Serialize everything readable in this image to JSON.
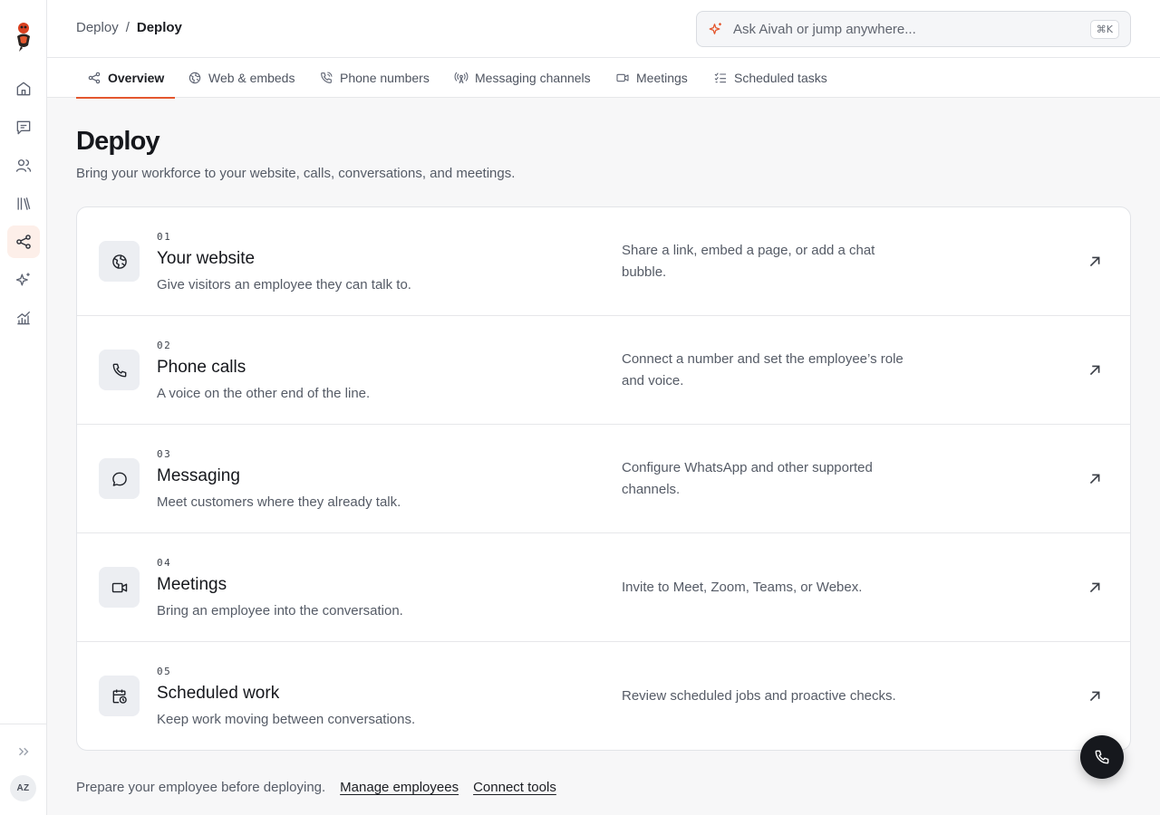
{
  "sidebar": {
    "logo": "aivah-mascot-logo",
    "items": [
      {
        "icon": "home-icon"
      },
      {
        "icon": "conversations-icon"
      },
      {
        "icon": "employees-icon"
      },
      {
        "icon": "library-icon"
      },
      {
        "icon": "deploy-icon",
        "active": true
      },
      {
        "icon": "sparkles-icon"
      },
      {
        "icon": "analytics-icon"
      }
    ],
    "avatar_initials": "AZ"
  },
  "header": {
    "breadcrumb": [
      "Deploy",
      "Deploy"
    ],
    "breadcrumb_separator": "/",
    "search_placeholder": "Ask Aivah or jump anywhere...",
    "search_shortcut": "⌘K"
  },
  "tabs": [
    {
      "label": "Overview",
      "icon": "share-icon",
      "active": true
    },
    {
      "label": "Web & embeds",
      "icon": "globe-icon"
    },
    {
      "label": "Phone numbers",
      "icon": "phone-ringing-icon"
    },
    {
      "label": "Messaging channels",
      "icon": "broadcast-icon"
    },
    {
      "label": "Meetings",
      "icon": "video-icon"
    },
    {
      "label": "Scheduled tasks",
      "icon": "checklist-icon"
    }
  ],
  "page": {
    "title": "Deploy",
    "subtitle": "Bring your workforce to your website, calls, conversations, and meetings."
  },
  "channels": [
    {
      "num": "01",
      "title": "Your website",
      "desc": "Give visitors an employee they can talk to.",
      "detail": "Share a link, embed a page, or add a chat bubble.",
      "icon": "globe-icon"
    },
    {
      "num": "02",
      "title": "Phone calls",
      "desc": "A voice on the other end of the line.",
      "detail": "Connect a number and set the employee’s role and voice.",
      "icon": "phone-icon"
    },
    {
      "num": "03",
      "title": "Messaging",
      "desc": "Meet customers where they already talk.",
      "detail": "Configure WhatsApp and other supported channels.",
      "icon": "chat-bubble-icon"
    },
    {
      "num": "04",
      "title": "Meetings",
      "desc": "Bring an employee into the conversation.",
      "detail": "Invite to Meet, Zoom, Teams, or Webex.",
      "icon": "video-icon"
    },
    {
      "num": "05",
      "title": "Scheduled work",
      "desc": "Keep work moving between conversations.",
      "detail": "Review scheduled jobs and proactive checks.",
      "icon": "calendar-clock-icon"
    }
  ],
  "footer": {
    "text": "Prepare your employee before deploying.",
    "link1": "Manage employees",
    "link2": "Connect tools"
  },
  "colors": {
    "accent": "#e4572e",
    "active_nav_bg": "#fdefe9"
  }
}
